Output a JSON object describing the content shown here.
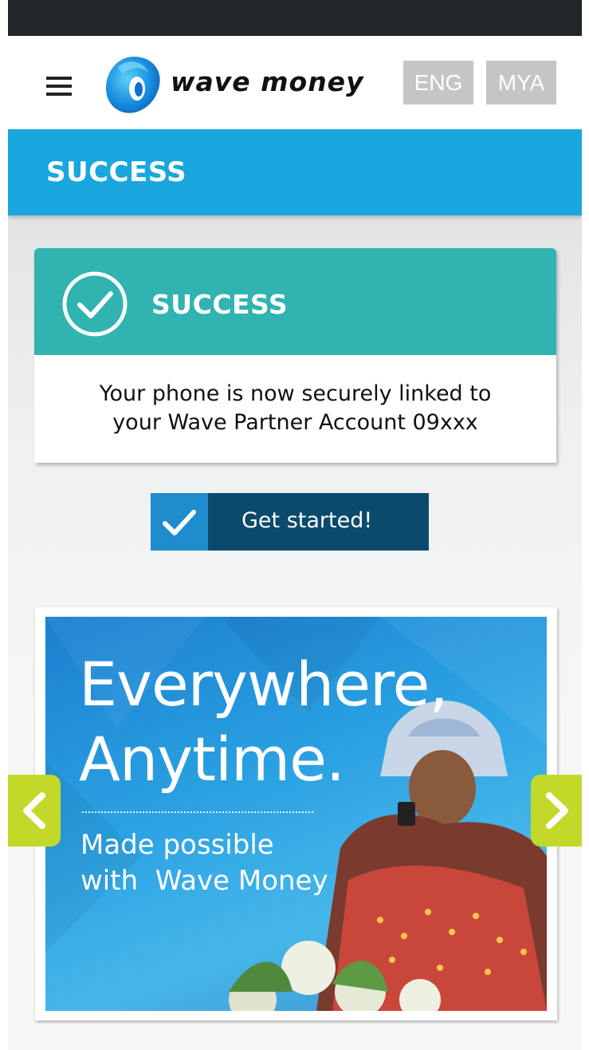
{
  "header": {
    "brand": "wave money",
    "lang_eng": "ENG",
    "lang_mya": "MYA"
  },
  "title_bar": {
    "title": "SUCCESS"
  },
  "success_card": {
    "heading": "SUCCESS",
    "message_line1": "Your phone is now securely linked to",
    "message_line2": "your Wave Partner Account 09xxx"
  },
  "cta": {
    "label": "Get started!"
  },
  "banner": {
    "headline_line1": "Everywhere,",
    "headline_line2": "Anytime.",
    "sub_line1": "Made possible",
    "sub_line2": "with  Wave Money"
  },
  "colors": {
    "brand_blue": "#1aa6df",
    "success_teal": "#30b3b1",
    "cta_dark": "#0b4a6d",
    "cta_icon": "#1f8ccd",
    "arrow_green": "#c3d92a"
  },
  "icons": [
    "menu-icon",
    "wave-logo-icon",
    "check-circle-icon",
    "checkmark-icon",
    "chevron-left-icon",
    "chevron-right-icon"
  ]
}
